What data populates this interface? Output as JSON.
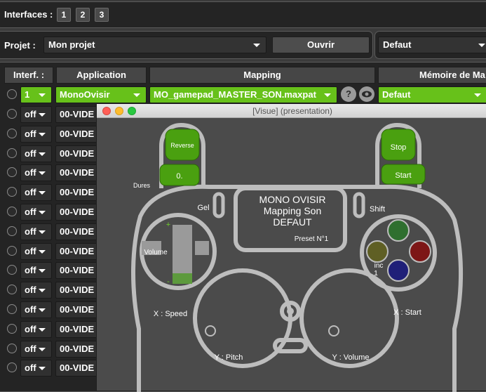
{
  "interfaces": {
    "label": "Interfaces :",
    "buttons": [
      "1",
      "2",
      "3"
    ]
  },
  "project": {
    "label": "Projet :",
    "value": "Mon projet",
    "open_button": "Ouvrir",
    "preset": "Defaut"
  },
  "table": {
    "headers": [
      "Interf. :",
      "Application",
      "Mapping",
      "Mémoire de Ma"
    ],
    "active_row": {
      "interface": "1",
      "application": "MonoOvisir",
      "mapping": "MO_gamepad_MASTER_SON.maxpat",
      "memory": "Defaut"
    },
    "rows": [
      {
        "interface": "off",
        "application": "00-VIDE"
      },
      {
        "interface": "off",
        "application": "00-VIDE"
      },
      {
        "interface": "off",
        "application": "00-VIDE"
      },
      {
        "interface": "off",
        "application": "00-VIDE"
      },
      {
        "interface": "off",
        "application": "00-VIDE"
      },
      {
        "interface": "off",
        "application": "00-VIDE"
      },
      {
        "interface": "off",
        "application": "00-VIDE"
      },
      {
        "interface": "off",
        "application": "00-VIDE"
      },
      {
        "interface": "off",
        "application": "00-VIDE"
      },
      {
        "interface": "off",
        "application": "00-VIDE"
      },
      {
        "interface": "off",
        "application": "00-VIDE"
      },
      {
        "interface": "off",
        "application": "00-VIDE"
      },
      {
        "interface": "off",
        "application": "00-VIDE"
      },
      {
        "interface": "off",
        "application": "00-VIDE"
      }
    ]
  },
  "icons": {
    "help": "question-icon",
    "view": "eye-icon"
  },
  "window": {
    "title": "[Visue] (presentation)",
    "controls": {
      "close": "#ff5f57",
      "minimize": "#febc2e",
      "zoom": "#28c840"
    }
  },
  "gamepad": {
    "reverse": "Reverse",
    "stop": "Stop",
    "start": "Start",
    "dures_label": "Dures",
    "dures_value": "0.",
    "gel": "Gel",
    "shift": "Shift",
    "screen_line1": "MONO OVISIR",
    "screen_line2": "Mapping Son",
    "screen_line3": "DEFAUT",
    "preset": "Preset N°1",
    "volume": "Volume",
    "volume_level": 0.18,
    "plus": "+",
    "minus": "-",
    "inc": "inc",
    "inc_value": "1",
    "x_speed": "X : Speed",
    "x_start": "X : Start",
    "y_pitch": "Y : Pitch",
    "y_volume": "Y : Volume",
    "colors": {
      "body": "#4b4b4b",
      "outline": "#bdbdbd",
      "accent": "#4aa010",
      "btn_green": "#2f6f2f",
      "btn_red": "#7d1616",
      "btn_blue": "#1f1f78",
      "btn_olive": "#5f5f24"
    }
  }
}
